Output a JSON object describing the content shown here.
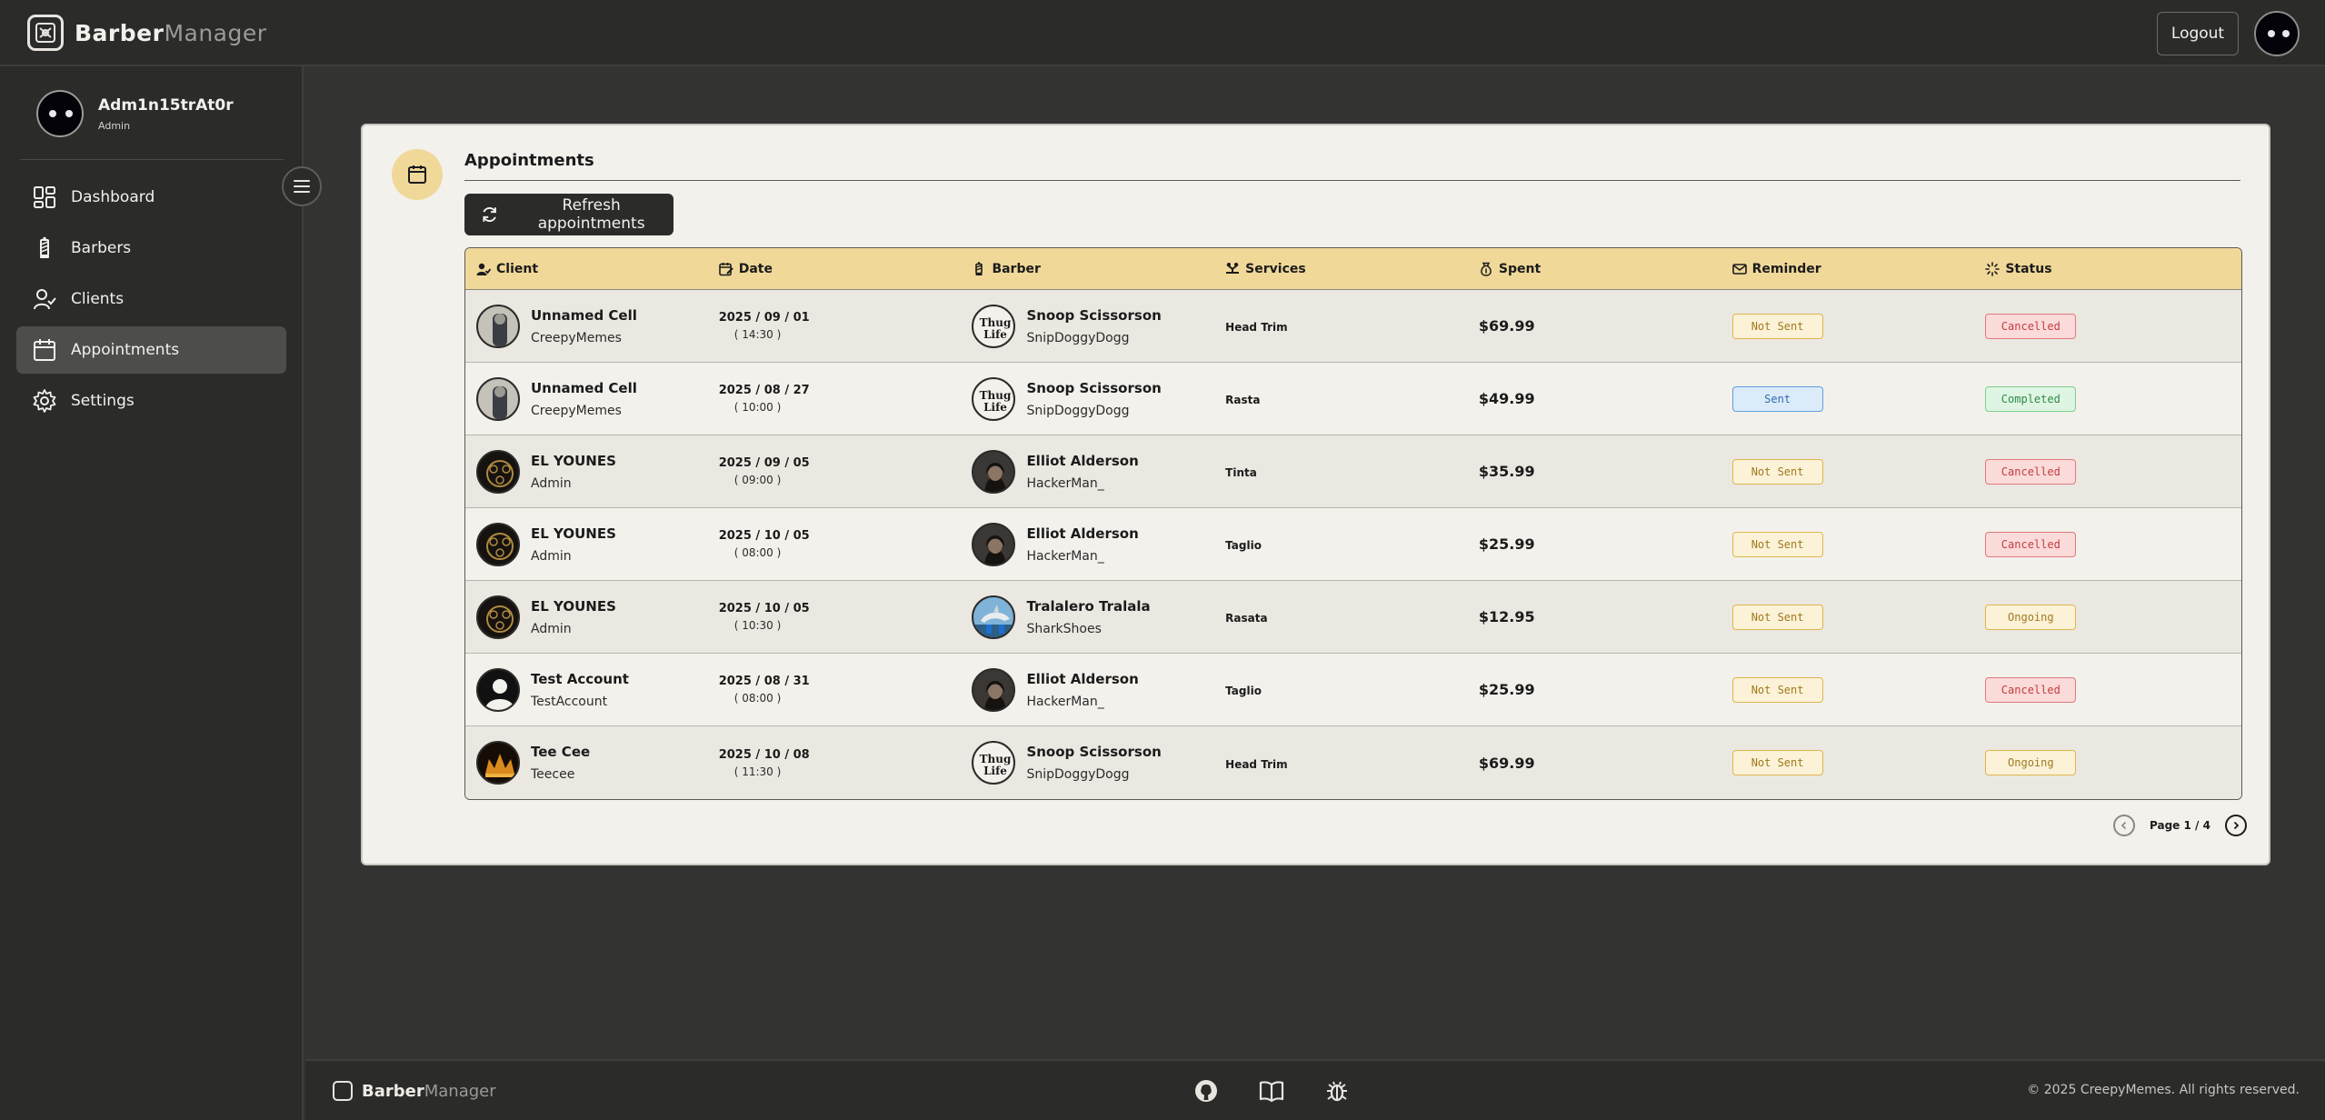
{
  "app": {
    "brand_primary": "Barber",
    "brand_secondary": "Manager"
  },
  "topbar": {
    "logout_label": "Logout"
  },
  "profile": {
    "name": "Adm1n15trAt0r",
    "role": "Admin"
  },
  "sidebar": {
    "items": [
      {
        "label": "Dashboard",
        "icon": "dashboard-icon",
        "active": false
      },
      {
        "label": "Barbers",
        "icon": "barber-pole-icon",
        "active": false
      },
      {
        "label": "Clients",
        "icon": "user-check-icon",
        "active": false
      },
      {
        "label": "Appointments",
        "icon": "calendar-icon",
        "active": true
      },
      {
        "label": "Settings",
        "icon": "gear-icon",
        "active": false
      }
    ]
  },
  "main": {
    "title": "Appointments",
    "refresh_label": "Refresh appointments",
    "columns": [
      "Client",
      "Date",
      "Barber",
      "Services",
      "Spent",
      "Reminder",
      "Status"
    ],
    "rows": [
      {
        "client_name": "Unnamed Cell",
        "client_user": "CreepyMemes",
        "date": "2025 / 09 / 01",
        "time": "( 14:30 )",
        "barber_name": "Snoop Scissorson",
        "barber_user": "SnipDoggyDogg",
        "service": "Head Trim",
        "spent": "$69.99",
        "reminder": "Not Sent",
        "status": "Cancelled"
      },
      {
        "client_name": "Unnamed Cell",
        "client_user": "CreepyMemes",
        "date": "2025 / 08 / 27",
        "time": "( 10:00 )",
        "barber_name": "Snoop Scissorson",
        "barber_user": "SnipDoggyDogg",
        "service": "Rasta",
        "spent": "$49.99",
        "reminder": "Sent",
        "status": "Completed"
      },
      {
        "client_name": "EL YOUNES",
        "client_user": "Admin",
        "date": "2025 / 09 / 05",
        "time": "( 09:00 )",
        "barber_name": "Elliot Alderson",
        "barber_user": "HackerMan_",
        "service": "Tinta",
        "spent": "$35.99",
        "reminder": "Not Sent",
        "status": "Cancelled"
      },
      {
        "client_name": "EL YOUNES",
        "client_user": "Admin",
        "date": "2025 / 10 / 05",
        "time": "( 08:00 )",
        "barber_name": "Elliot Alderson",
        "barber_user": "HackerMan_",
        "service": "Taglio",
        "spent": "$25.99",
        "reminder": "Not Sent",
        "status": "Cancelled"
      },
      {
        "client_name": "EL YOUNES",
        "client_user": "Admin",
        "date": "2025 / 10 / 05",
        "time": "( 10:30 )",
        "barber_name": "Tralalero Tralala",
        "barber_user": "SharkShoes",
        "service": "Rasata",
        "spent": "$12.95",
        "reminder": "Not Sent",
        "status": "Ongoing"
      },
      {
        "client_name": "Test Account",
        "client_user": "TestAccount",
        "date": "2025 / 08 / 31",
        "time": "( 08:00 )",
        "barber_name": "Elliot Alderson",
        "barber_user": "HackerMan_",
        "service": "Taglio",
        "spent": "$25.99",
        "reminder": "Not Sent",
        "status": "Cancelled"
      },
      {
        "client_name": "Tee Cee",
        "client_user": "Teecee",
        "date": "2025 / 10 / 08",
        "time": "( 11:30 )",
        "barber_name": "Snoop Scissorson",
        "barber_user": "SnipDoggyDogg",
        "service": "Head Trim",
        "spent": "$69.99",
        "reminder": "Not Sent",
        "status": "Ongoing"
      }
    ],
    "pagination": {
      "label": "Page 1 / 4"
    }
  },
  "footer": {
    "copyright": "© 2025 CreepyMemes. All rights reserved."
  },
  "colors": {
    "accent": "#f0d899",
    "dark": "#2b2b2a",
    "card_bg": "#f3f1ec"
  }
}
